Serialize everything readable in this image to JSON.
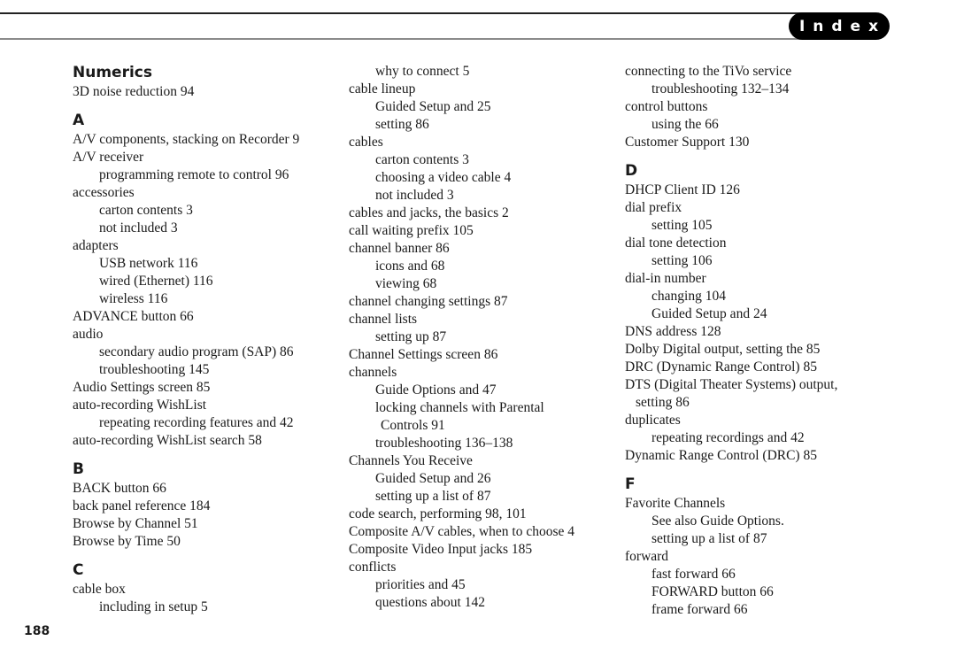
{
  "header": {
    "section_tab": "Index"
  },
  "page_number": "188",
  "columns": [
    {
      "blocks": [
        {
          "heading": "Numerics",
          "entries": [
            {
              "text": "3D noise reduction 94",
              "level": 1
            }
          ]
        },
        {
          "heading": "A",
          "entries": [
            {
              "text": "A/V components, stacking on Recorder 9",
              "level": 1
            },
            {
              "text": "A/V receiver",
              "level": 1
            },
            {
              "text": "programming remote to control 96",
              "level": 2
            },
            {
              "text": "accessories",
              "level": 1
            },
            {
              "text": "carton contents 3",
              "level": 2
            },
            {
              "text": "not included 3",
              "level": 2
            },
            {
              "text": "adapters",
              "level": 1
            },
            {
              "text": "USB network 116",
              "level": 2
            },
            {
              "text": "wired (Ethernet) 116",
              "level": 2
            },
            {
              "text": "wireless 116",
              "level": 2
            },
            {
              "text": "ADVANCE button 66",
              "level": 1
            },
            {
              "text": "audio",
              "level": 1
            },
            {
              "text": "secondary audio program (SAP) 86",
              "level": 2
            },
            {
              "text": "troubleshooting 145",
              "level": 2
            },
            {
              "text": "Audio Settings screen 85",
              "level": 1
            },
            {
              "text": "auto-recording WishList",
              "level": 1
            },
            {
              "text": "repeating recording features and 42",
              "level": 2
            },
            {
              "text": "auto-recording WishList search 58",
              "level": 1
            }
          ]
        },
        {
          "heading": "B",
          "entries": [
            {
              "text": "BACK button 66",
              "level": 1
            },
            {
              "text": "back panel reference 184",
              "level": 1
            },
            {
              "text": "Browse by Channel 51",
              "level": 1
            },
            {
              "text": "Browse by Time 50",
              "level": 1
            }
          ]
        },
        {
          "heading": "C",
          "entries": [
            {
              "text": "cable box",
              "level": 1
            },
            {
              "text": "including in setup 5",
              "level": 2
            }
          ]
        }
      ]
    },
    {
      "blocks": [
        {
          "heading": null,
          "entries": [
            {
              "text": "why to connect 5",
              "level": 2
            },
            {
              "text": "cable lineup",
              "level": 1
            },
            {
              "text": "Guided Setup and 25",
              "level": 2
            },
            {
              "text": "setting 86",
              "level": 2
            },
            {
              "text": "cables",
              "level": 1
            },
            {
              "text": "carton contents 3",
              "level": 2
            },
            {
              "text": "choosing a video cable 4",
              "level": 2
            },
            {
              "text": "not included 3",
              "level": 2
            },
            {
              "text": "cables and jacks, the basics 2",
              "level": 1
            },
            {
              "text": "call waiting prefix 105",
              "level": 1
            },
            {
              "text": "channel banner 86",
              "level": 1
            },
            {
              "text": "icons and 68",
              "level": 2
            },
            {
              "text": "viewing 68",
              "level": 2
            },
            {
              "text": "channel changing settings 87",
              "level": 1
            },
            {
              "text": "channel lists",
              "level": 1
            },
            {
              "text": "setting up 87",
              "level": 2
            },
            {
              "text": "Channel Settings screen 86",
              "level": 1
            },
            {
              "text": "channels",
              "level": 1
            },
            {
              "text": "Guide Options and 47",
              "level": 2
            },
            {
              "text": "locking channels with Parental",
              "level": 2
            },
            {
              "text": "Controls 91",
              "level": "cont2"
            },
            {
              "text": "troubleshooting 136–138",
              "level": 2
            },
            {
              "text": "Channels You Receive",
              "level": 1
            },
            {
              "text": "Guided Setup and 26",
              "level": 2
            },
            {
              "text": "setting up a list of 87",
              "level": 2
            },
            {
              "text": "code search, performing 98, 101",
              "level": 1
            },
            {
              "text": "Composite A/V cables, when to choose 4",
              "level": 1
            },
            {
              "text": "Composite Video Input jacks 185",
              "level": 1
            },
            {
              "text": "conflicts",
              "level": 1
            },
            {
              "text": "priorities and 45",
              "level": 2
            },
            {
              "text": "questions about 142",
              "level": 2
            }
          ]
        }
      ]
    },
    {
      "blocks": [
        {
          "heading": null,
          "entries": [
            {
              "text": "connecting to the TiVo service",
              "level": 1
            },
            {
              "text": "troubleshooting 132–134",
              "level": 2
            },
            {
              "text": "control buttons",
              "level": 1
            },
            {
              "text": "using the 66",
              "level": 2
            },
            {
              "text": "Customer Support 130",
              "level": 1
            }
          ]
        },
        {
          "heading": "D",
          "entries": [
            {
              "text": "DHCP Client ID 126",
              "level": 1
            },
            {
              "text": "dial prefix",
              "level": 1
            },
            {
              "text": "setting 105",
              "level": 2
            },
            {
              "text": "dial tone detection",
              "level": 1
            },
            {
              "text": "setting 106",
              "level": 2
            },
            {
              "text": "dial-in number",
              "level": 1
            },
            {
              "text": "changing 104",
              "level": 2
            },
            {
              "text": "Guided Setup and 24",
              "level": 2
            },
            {
              "text": "DNS address 128",
              "level": 1
            },
            {
              "text": "Dolby Digital output, setting the 85",
              "level": 1
            },
            {
              "text": "DRC (Dynamic Range Control) 85",
              "level": 1
            },
            {
              "text": "DTS (Digital Theater Systems) output,",
              "level": 1
            },
            {
              "text": "setting 86",
              "level": "cont"
            },
            {
              "text": "duplicates",
              "level": 1
            },
            {
              "text": "repeating recordings and 42",
              "level": 2
            },
            {
              "text": "Dynamic Range Control (DRC) 85",
              "level": 1
            }
          ]
        },
        {
          "heading": "F",
          "entries": [
            {
              "text": "Favorite Channels",
              "level": 1
            },
            {
              "text": "See also Guide Options.",
              "level": 2
            },
            {
              "text": "setting up a list of 87",
              "level": 2
            },
            {
              "text": "forward",
              "level": 1
            },
            {
              "text": "fast forward 66",
              "level": 2
            },
            {
              "text": "FORWARD button 66",
              "level": 2
            },
            {
              "text": "frame forward 66",
              "level": 2
            }
          ]
        }
      ]
    }
  ]
}
